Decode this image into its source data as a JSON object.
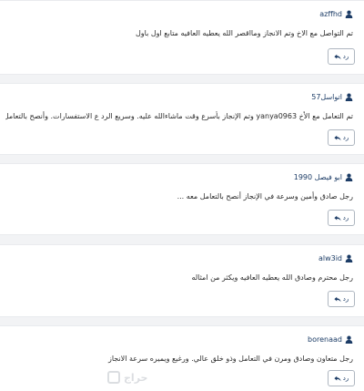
{
  "comments": [
    {
      "author": "azffhd",
      "text": "تم التواصل مع الاخ وتم الانجاز ومااقصر الله يعطيه العافيه متابع اول باول",
      "reply_label": "رد"
    },
    {
      "author": "اتواسل57",
      "text": "تم التعامل مع الأخ yanya0963 وتم الإنجاز بأسرع وقت ماشاءالله عليه. وسريع الرد ع الاستفسارات. وأنصح بالتعامل معه.",
      "reply_label": "رد"
    },
    {
      "author": "ابو فيصل 1990",
      "text": "رجل صادق وأمين وسرعة في الإنجاز أنصح بالتعامل معه ...",
      "reply_label": "رد"
    },
    {
      "author": "alw3id",
      "text": "رجل محترم وصادق الله يعطيه العافيه ويكثر من امثاله",
      "reply_label": "رد"
    },
    {
      "author": "borenaad",
      "text": "رجل متعاون وصادق ومرن في التعامل وذو خلق عالي. ورغيع ويميره سرعة الانجاز",
      "reply_label": "رد"
    }
  ],
  "watermark": {
    "text": "حراج"
  },
  "colors": {
    "author": "#1c3c66",
    "text": "#2b2b2b",
    "background": "#f2f3f5",
    "card": "#ffffff"
  }
}
